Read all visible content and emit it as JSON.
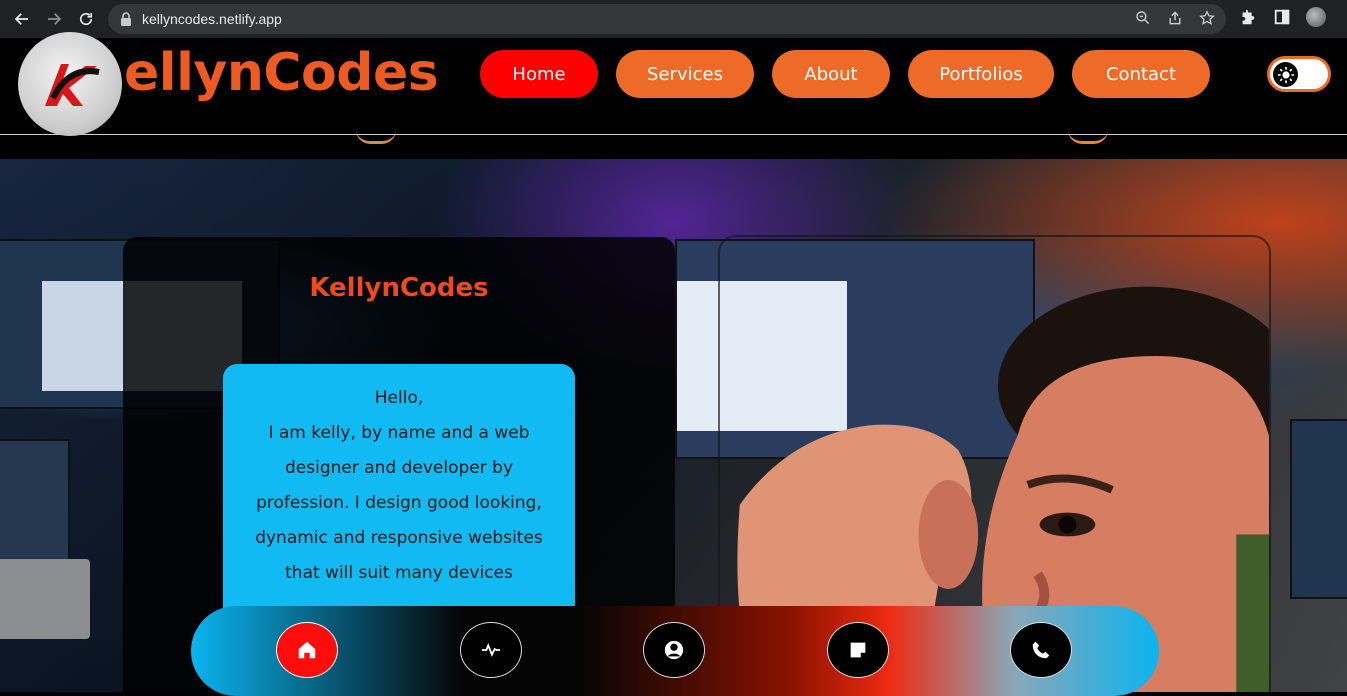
{
  "browser": {
    "url": "kellyncodes.netlify.app",
    "icons": [
      "back-arrow-icon",
      "forward-arrow-icon",
      "reload-icon",
      "lock-icon",
      "zoom-icon",
      "share-icon",
      "star-icon",
      "extensions-icon",
      "sidebar-icon",
      "profile-avatar",
      "kebab-menu-icon"
    ]
  },
  "site": {
    "brand": "ellynCodes",
    "nav": [
      {
        "label": "Home",
        "active": true
      },
      {
        "label": "Services",
        "active": false
      },
      {
        "label": "About",
        "active": false
      },
      {
        "label": "Portfolios",
        "active": false
      },
      {
        "label": "Contact",
        "active": false
      }
    ],
    "theme_toggle_icon": "sun-icon"
  },
  "hero": {
    "card_title": "KellynCodes",
    "about_lines": [
      "Hello,",
      "I am kelly, by name and a web",
      "designer and developer by",
      "profession. I design good looking,",
      "dynamic and responsive websites",
      "that will suit many devices"
    ]
  },
  "dock": {
    "buttons": [
      {
        "icon": "home-icon",
        "active": true
      },
      {
        "icon": "activity-icon",
        "active": false
      },
      {
        "icon": "user-icon",
        "active": false
      },
      {
        "icon": "note-icon",
        "active": false
      },
      {
        "icon": "phone-icon",
        "active": false
      }
    ]
  },
  "colors": {
    "accent_orange": "#ee6a28",
    "active_red": "#ff0000",
    "brand_orange": "#ee5a24",
    "about_blue": "#11baf3"
  }
}
